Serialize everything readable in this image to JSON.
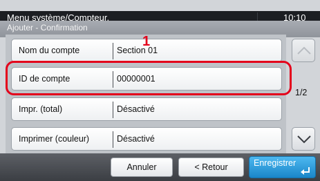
{
  "header": {
    "title": "Menu système/Compteur.",
    "time": "10:10",
    "subtitle": "Ajouter - Confirmation"
  },
  "rows": [
    {
      "label": "Nom du compte",
      "value": "Section 01"
    },
    {
      "label": "ID de compte",
      "value": "00000001"
    },
    {
      "label": "Impr. (total)",
      "value": "Désactivé"
    },
    {
      "label": "Imprimer (couleur)",
      "value": "Désactivé"
    }
  ],
  "callout": "1",
  "pager": {
    "indicator": "1/2",
    "up_icon": "chevron-up-icon",
    "down_icon": "chevron-down-icon"
  },
  "footer": {
    "cancel_label": "Annuler",
    "back_label": "< Retour",
    "save_label": "Enregistrer",
    "save_icon": "enter-icon"
  },
  "colors": {
    "highlight": "#e4001b",
    "primary": "#1a86c9",
    "titlebar": "#1c1e22"
  }
}
